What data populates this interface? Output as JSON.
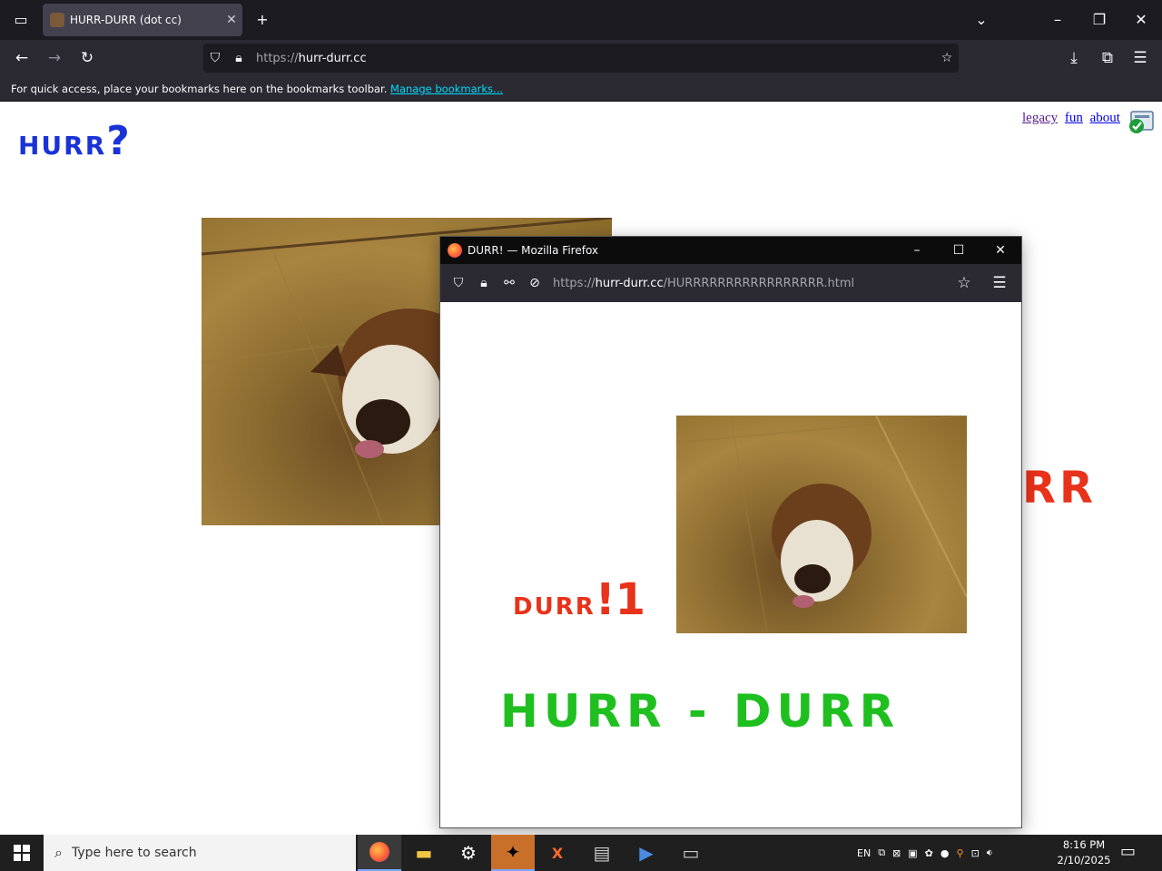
{
  "browser": {
    "tab_title": "HURR-DURR (dot cc)",
    "url_prefix": "https://",
    "url_host": "hurr-durr.cc",
    "bookmarks_message": "For quick access, place your bookmarks here on the bookmarks toolbar.",
    "manage_bookmarks": "Manage bookmarks..."
  },
  "page": {
    "logo_text": "HURR",
    "logo_mark": "?",
    "links": [
      "legacy",
      "fun",
      "about"
    ],
    "big_text": "RR"
  },
  "popup": {
    "title": "DURR! — Mozilla Firefox",
    "url_prefix": "https://",
    "url_host": "hurr-durr.cc",
    "url_path": "/HURRRRRRRRRRRRRRRRR.html",
    "durr_small": "DURR",
    "durr_large": "!1",
    "hurr_durr": "HURR - DURR"
  },
  "taskbar": {
    "search_placeholder": "Type here to search",
    "lang": "EN",
    "time": "8:16 PM",
    "date": "2/10/2025"
  },
  "colors": {
    "logo_blue": "#1a33d6",
    "accent_red": "#e8321a",
    "accent_green": "#1fbf1f"
  }
}
